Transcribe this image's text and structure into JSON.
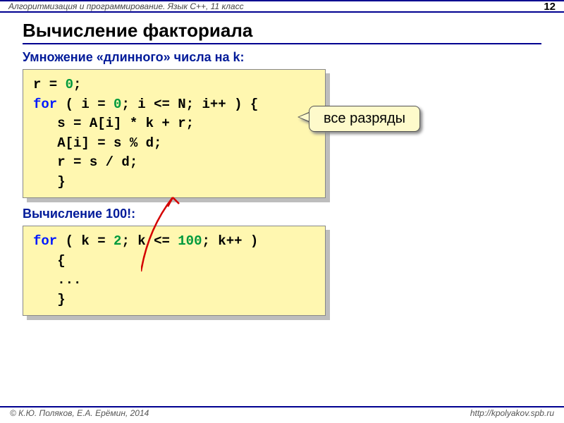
{
  "header": {
    "course": "Алгоритмизация и программирование. Язык C++, 11 класс",
    "page": "12"
  },
  "title": "Вычисление факториала",
  "section1": {
    "heading": "Умножение «длинного» числа на k:",
    "callout": "все разряды",
    "code": {
      "l1a": "r",
      "l1b": " = ",
      "l1c": "0",
      "l1d": ";",
      "l2a": "for",
      "l2b": " ( i",
      "l2c": " = ",
      "l2d": "0",
      "l2e": "; i",
      "l2f": " <= N; i++ ) {",
      "l3": "   s = A[i] * k + r;",
      "l4": "   A[i] = s % d;",
      "l5": "   r = s / d;",
      "l6": "   }"
    }
  },
  "section2": {
    "heading": "Вычисление 100!:",
    "code": {
      "l1a": "for",
      "l1b": " ( k",
      "l1c": " = ",
      "l1d": "2",
      "l1e": "; k",
      "l1f": " <= ",
      "l1g": "100",
      "l1h": "; k++ )",
      "l2": "   {",
      "l3": "   ...",
      "l4": "   }"
    }
  },
  "footer": {
    "left": "© К.Ю. Поляков, Е.А. Ерёмин, 2014",
    "right": "http://kpolyakov.spb.ru"
  }
}
